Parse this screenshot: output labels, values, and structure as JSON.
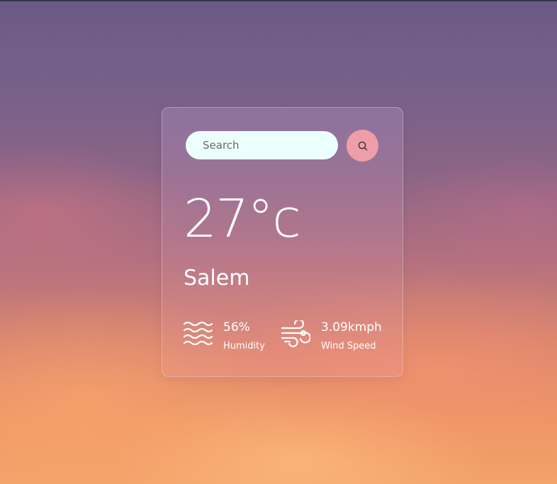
{
  "search": {
    "placeholder": "Search",
    "button_icon": "search-icon"
  },
  "weather": {
    "temperature": "27",
    "unit": "°c",
    "city": "Salem",
    "humidity": {
      "value": "56%",
      "label": "Humidity",
      "icon": "water-waves-icon"
    },
    "wind": {
      "value": "3.09kmph",
      "label": "Wind Speed",
      "icon": "wind-icon"
    }
  },
  "colors": {
    "search_field_bg": "#ebfffc",
    "search_button_bg": "#ee9ea6",
    "text": "#ffffff"
  }
}
